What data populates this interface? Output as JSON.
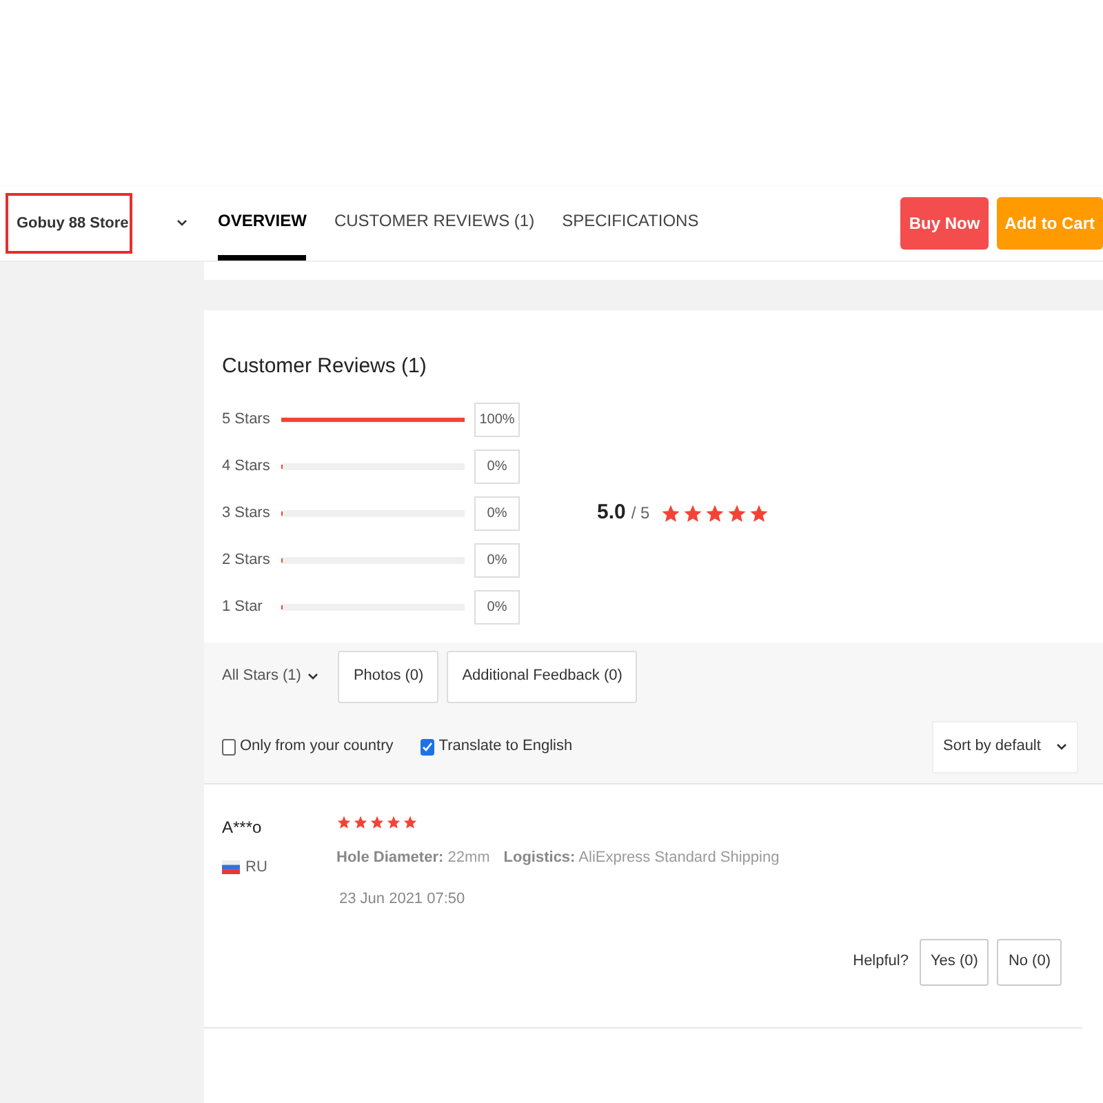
{
  "store": {
    "name": "Gobuy 88 Store"
  },
  "tabs": [
    {
      "label": "OVERVIEW",
      "selected": true
    },
    {
      "label": "CUSTOMER REVIEWS (1)",
      "selected": false
    },
    {
      "label": "SPECIFICATIONS",
      "selected": false
    }
  ],
  "actions": [
    {
      "label": "Buy Now",
      "kind": "buy"
    },
    {
      "label": "Add to Cart",
      "kind": "cart"
    }
  ],
  "reviews": {
    "title": "Customer Reviews (1)",
    "distribution": [
      {
        "label": "5 Stars",
        "level": 1,
        "percent": "100%"
      },
      {
        "label": "4 Stars",
        "level": 0,
        "percent": "0%"
      },
      {
        "label": "3 Stars",
        "level": 0,
        "percent": "0%"
      },
      {
        "label": "2 Stars",
        "level": 0,
        "percent": "0%"
      },
      {
        "label": "1 Star",
        "level": 0,
        "percent": "0%"
      }
    ],
    "score": "5.0",
    "out_of": "/ 5",
    "stars": 5
  },
  "filters": {
    "star_filter": "All Stars (1)",
    "buttons": [
      "Photos (0)",
      "Additional Feedback (0)"
    ],
    "checkboxes": [
      {
        "label": "Only from your country",
        "checked": false
      },
      {
        "label": "Translate to English",
        "checked": true
      }
    ],
    "sort": "Sort by default"
  },
  "review": {
    "author": "A***o",
    "country": "RU",
    "stars": 5,
    "attributes": [
      {
        "label": "Hole Diameter:",
        "value": "22mm"
      },
      {
        "label": "Logistics:",
        "value": "AliExpress Standard Shipping"
      }
    ],
    "date": "23 Jun 2021 07:50",
    "helpful": "Helpful?",
    "votes": [
      "Yes (0)",
      "No (0)"
    ]
  }
}
